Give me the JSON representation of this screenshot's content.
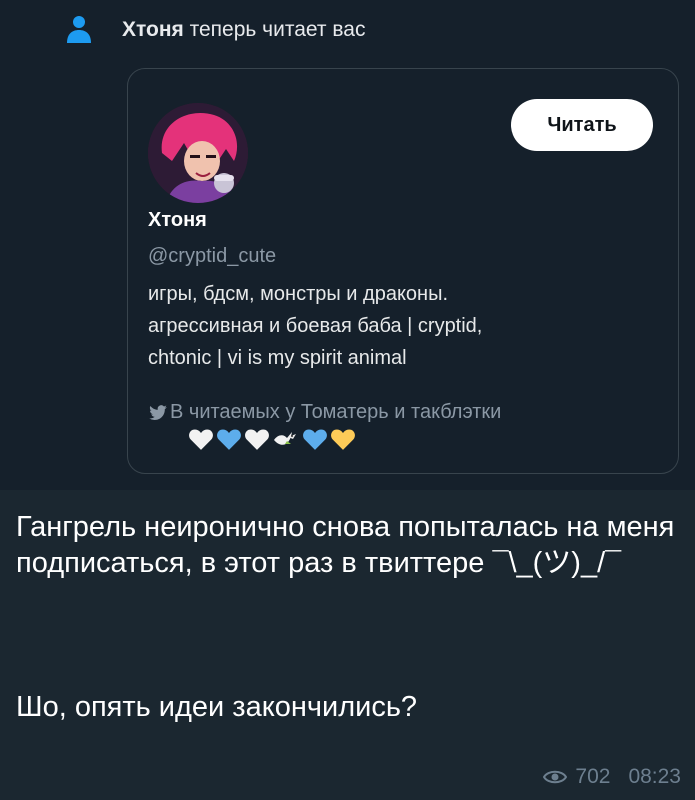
{
  "notification": {
    "name": "Хтоня",
    "text": " теперь читает вас",
    "icon": "person-icon"
  },
  "profile_card": {
    "follow_button": "Читать",
    "display_name": "Хтоня",
    "handle": "@cryptid_cute",
    "bio_lines": [
      "игры, бдсм, монстры и драконы.",
      "агрессивная и боевая баба | cryptid,",
      "chtonic | vi is my spirit animal"
    ],
    "followed_by": "В читаемых у Томатерь и такблэтки",
    "followed_by_icon": "twitter-bird-icon",
    "hearts": [
      "white-heart-icon",
      "blue-heart-icon",
      "white-heart-icon",
      "dove-icon",
      "blue-heart-icon",
      "yellow-heart-icon"
    ]
  },
  "message": {
    "paragraph1": "Гангрель неиронично снова попыталась на меня подписаться, в этот раз в твиттере ¯\\_(ツ)_/¯",
    "paragraph2": "Шо, опять идеи закончились?"
  },
  "meta": {
    "views": "702",
    "time": "08:23",
    "views_icon": "eye-icon"
  },
  "colors": {
    "chat_background": "#1b2730",
    "screenshot_background": "#15202b",
    "card_border": "#38444d",
    "secondary_text": "#8b98a5",
    "meta_text": "#6d7f8f",
    "accent_blue": "#1d9bf0"
  }
}
